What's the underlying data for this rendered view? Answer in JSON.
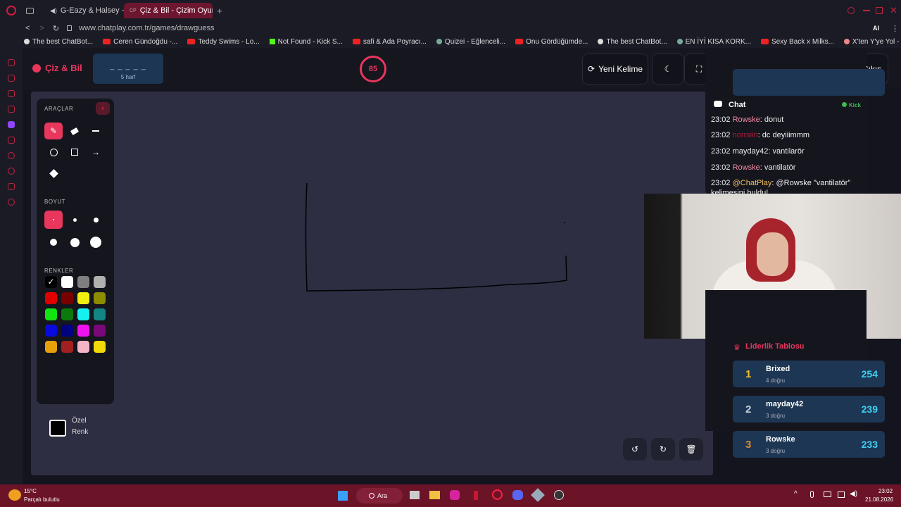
{
  "browser": {
    "tabs": [
      {
        "label": "G-Eazy & Halsey - Him"
      },
      {
        "label": "Çiz & Bil - Çizim Oyunu"
      }
    ],
    "url": "www.chatplay.com.tr/games/drawguess",
    "ai_label": "AI"
  },
  "bookmarks": [
    "The best ChatBot...",
    "Ceren Gündoğdu -...",
    "Teddy Swims - Lo...",
    "Not Found - Kick S...",
    "safi & Ada Poyracı...",
    "Quizei - Eğlenceli...",
    "Onu Gördüğümde...",
    "The best ChatBot...",
    "EN İYİ KISA KORK...",
    "Sexy Back x Milks...",
    "X'ten Y'ye Yol - Oy..."
  ],
  "app": {
    "logo": "Çiz & Bil",
    "word_mask": "_ _ _ _ _",
    "word_len": "5 harf",
    "timer": "85",
    "new_word": "Yeni Kelime",
    "exit": "Çıkış"
  },
  "tools": {
    "title": "ARAÇLAR",
    "size_title": "BOYUT",
    "color_title": "RENKLER",
    "custom_line1": "Özel",
    "custom_line2": "Renk",
    "colors": [
      "#000000",
      "#ffffff",
      "#7f7f7f",
      "#b0b0b0",
      "#e00000",
      "#7a0000",
      "#f2ef10",
      "#8c8c00",
      "#12e312",
      "#0b7a0b",
      "#15f0f0",
      "#138585",
      "#0a0adc",
      "#000080",
      "#ee12ee",
      "#7a087a",
      "#e6a00a",
      "#a32020",
      "#f5b5c8",
      "#f2d90a"
    ]
  },
  "chat": {
    "title": "Chat",
    "source": "Kick",
    "messages": [
      {
        "time": "23:02",
        "user": "Rowske",
        "text": ": donut",
        "color": "#f38ba0"
      },
      {
        "time": "23:02",
        "user": "norrsiin",
        "text": ": dc deyiiimmm",
        "color": "#b01c38"
      },
      {
        "time": "23:02",
        "user": "mayday42",
        "text": ": vantilarör",
        "color": "#eeeeee"
      },
      {
        "time": "23:02",
        "user": "Rowske",
        "text": ": vantilatör",
        "color": "#f38ba0"
      },
      {
        "time": "23:02",
        "user": "@ChatPlay",
        "text": ": @Rowske \"vantilatör\"",
        "color": "#f2c25a"
      }
    ],
    "cut_line": "kelimesini buldu!"
  },
  "leaderboard": {
    "title": "Liderlik Tablosu",
    "rows": [
      {
        "rank": "1",
        "name": "Brixed",
        "sub": "4 doğru",
        "score": "254",
        "rank_color": "#f2c230"
      },
      {
        "rank": "2",
        "name": "mayday42",
        "sub": "3 doğru",
        "score": "239",
        "rank_color": "#c8d2dc"
      },
      {
        "rank": "3",
        "name": "Rowske",
        "sub": "3 doğru",
        "score": "233",
        "rank_color": "#d78a3a"
      }
    ]
  },
  "taskbar": {
    "temp": "15°C",
    "weather": "Parçalı bulutlu",
    "search": "Ara",
    "time": "23:02",
    "date": "21.08.2026"
  }
}
